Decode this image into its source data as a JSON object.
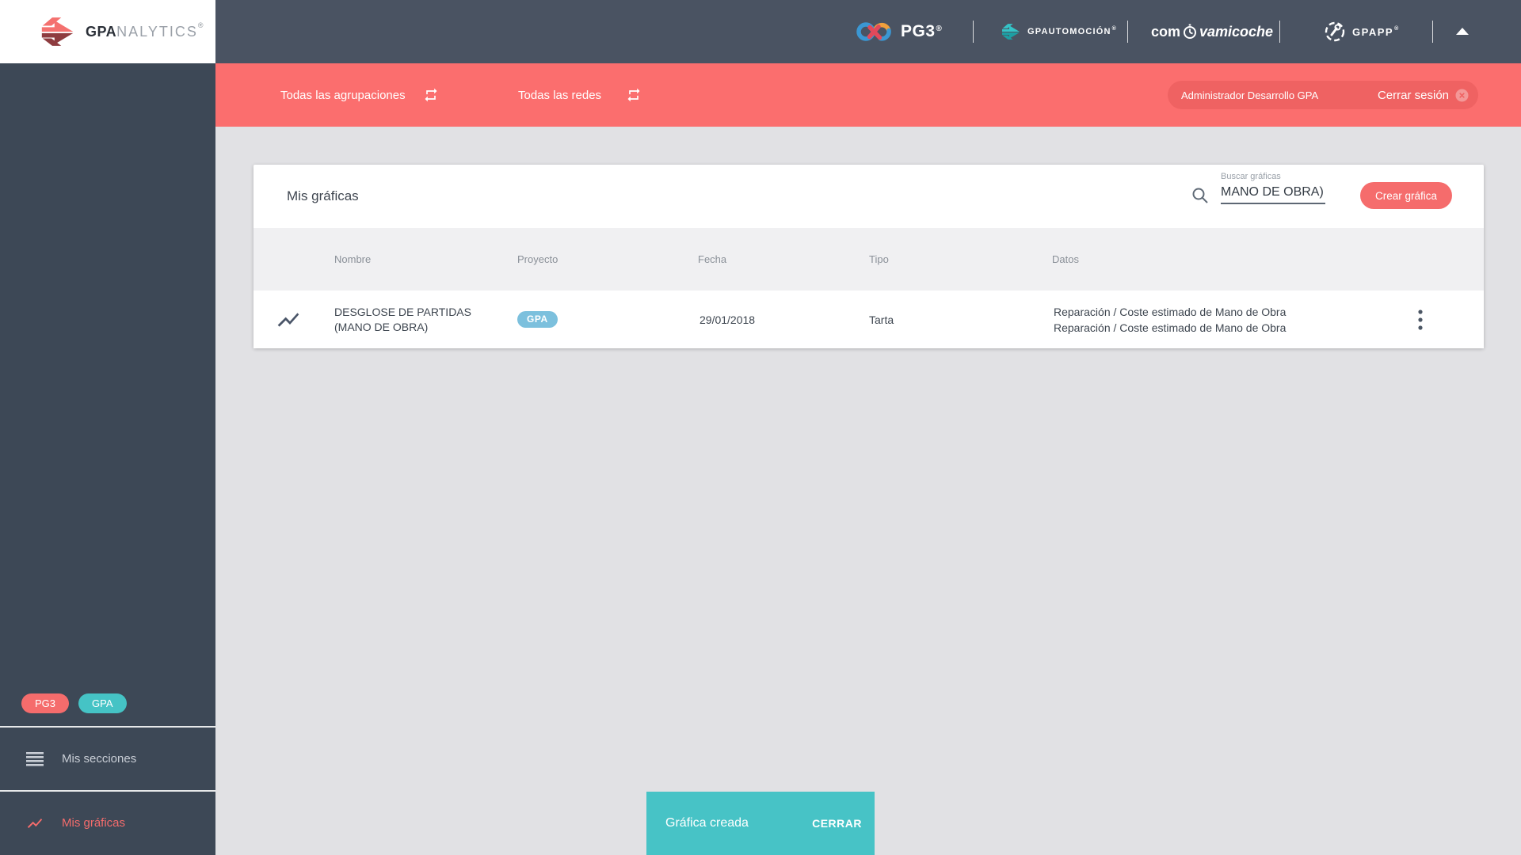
{
  "sidebar": {
    "logo": {
      "bold": "GPA",
      "light": "NALYTICS",
      "reg": "®"
    },
    "badges": [
      "PG3",
      "GPA"
    ],
    "items": [
      {
        "label": "Mis secciones",
        "active": false
      },
      {
        "label": "Mis gráficas",
        "active": true
      }
    ]
  },
  "header": {
    "pg3": {
      "label": "PG3",
      "reg": "®"
    },
    "gpautomocion": {
      "label": "GPAUTOMOCIÓN",
      "reg": "®"
    },
    "comprovamicoche": {
      "pre": "com",
      "post": "vamicoche"
    },
    "gpapp": {
      "label": "GPAPP",
      "reg": "®"
    }
  },
  "topbar": {
    "filters": [
      {
        "label": "Todas las agrupaciones"
      },
      {
        "label": "Todas las redes"
      }
    ],
    "user_label": "Administrador Desarrollo GPA",
    "logout_label": "Cerrar sesión"
  },
  "panel": {
    "title": "Mis gráficas",
    "search": {
      "label": "Buscar gráficas",
      "value": "MANO DE OBRA)"
    },
    "create_label": "Crear gráfica",
    "table": {
      "columns": [
        "Nombre",
        "Proyecto",
        "Fecha",
        "Tipo",
        "Datos"
      ],
      "rows": [
        {
          "name": "DESGLOSE DE PARTIDAS (MANO DE OBRA)",
          "project": "GPA",
          "date": "29/01/2018",
          "type": "Tarta",
          "data": [
            "Reparación / Coste estimado de Mano de Obra",
            "Reparación / Coste estimado de Mano de Obra"
          ]
        }
      ]
    }
  },
  "toast": {
    "message": "Gráfica creada",
    "action": "CERRAR"
  },
  "colors": {
    "accent_red": "#f56c6c",
    "bar_red": "#fb6e6e",
    "teal": "#47c3c6",
    "badge_blue": "#7cc0dd",
    "header_dark": "#4a5362",
    "sidebar_dark": "#3d4856",
    "page_bg": "#e1e1e4"
  }
}
